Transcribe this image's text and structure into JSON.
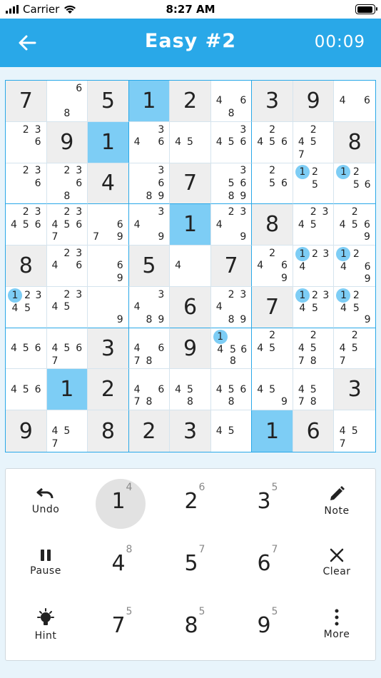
{
  "status_bar": {
    "carrier": "Carrier",
    "time": "8:27 AM"
  },
  "header": {
    "title": "Easy #2",
    "timer": "00:09"
  },
  "board": [
    [
      {
        "v": "7",
        "p": 1
      },
      {
        "n": [
          "",
          "",
          "6",
          "",
          "",
          "",
          "",
          "8",
          ""
        ]
      },
      {
        "v": "5",
        "p": 1
      },
      {
        "v": "1",
        "s": 1
      },
      {
        "v": "2",
        "p": 1
      },
      {
        "n": [
          "",
          "",
          "",
          "4",
          "",
          "6",
          "",
          "8",
          ""
        ]
      },
      {
        "v": "3",
        "p": 1
      },
      {
        "v": "9",
        "p": 1
      },
      {
        "n": [
          "",
          "",
          "",
          "4",
          "",
          "6",
          "",
          "",
          ""
        ]
      }
    ],
    [
      {
        "n": [
          "",
          "2",
          "3",
          "",
          "",
          "6",
          "",
          "",
          ""
        ]
      },
      {
        "v": "9",
        "p": 1
      },
      {
        "v": "1",
        "s": 1
      },
      {
        "n": [
          "",
          "",
          "3",
          "4",
          "",
          "6",
          "",
          "",
          ""
        ]
      },
      {
        "n": [
          "",
          "",
          "",
          "4",
          "5",
          "",
          "",
          "",
          ""
        ]
      },
      {
        "n": [
          "",
          "",
          "3",
          "4",
          "5",
          "6",
          "",
          "",
          ""
        ]
      },
      {
        "n": [
          "",
          "2",
          "",
          "4",
          "5",
          "6",
          "",
          "",
          ""
        ]
      },
      {
        "n": [
          "",
          "2",
          "",
          "4",
          "5",
          "",
          "7",
          "",
          ""
        ]
      },
      {
        "v": "8",
        "p": 1
      }
    ],
    [
      {
        "n": [
          "",
          "2",
          "3",
          "",
          "",
          "6",
          "",
          "",
          ""
        ]
      },
      {
        "n": [
          "",
          "2",
          "3",
          "",
          "",
          "6",
          "",
          "8",
          ""
        ]
      },
      {
        "v": "4",
        "p": 1
      },
      {
        "n": [
          "",
          "",
          "3",
          "",
          "",
          "6",
          "",
          "8",
          "9"
        ]
      },
      {
        "v": "7",
        "p": 1
      },
      {
        "n": [
          "",
          "",
          "3",
          "",
          "5",
          "6",
          "",
          "8",
          "9"
        ]
      },
      {
        "n": [
          "",
          "2",
          "",
          "",
          "5",
          "6",
          "",
          "",
          ""
        ]
      },
      {
        "n": [
          "1",
          "2",
          "",
          "",
          "5",
          "",
          "",
          "",
          ""
        ],
        "h": 0
      },
      {
        "n": [
          "1",
          "2",
          "",
          "",
          "5",
          "6",
          "",
          "",
          ""
        ],
        "h": 0
      }
    ],
    [
      {
        "n": [
          "",
          "2",
          "3",
          "4",
          "5",
          "6",
          "",
          "",
          ""
        ]
      },
      {
        "n": [
          "",
          "2",
          "3",
          "4",
          "5",
          "6",
          "7",
          "",
          ""
        ]
      },
      {
        "n": [
          "",
          "",
          "",
          "",
          "",
          "6",
          "7",
          "",
          "9"
        ]
      },
      {
        "n": [
          "",
          "",
          "3",
          "4",
          "",
          "",
          "",
          "",
          "9"
        ]
      },
      {
        "v": "1",
        "s": 1
      },
      {
        "n": [
          "",
          "2",
          "3",
          "4",
          "",
          "",
          "",
          "",
          "9"
        ]
      },
      {
        "v": "8",
        "p": 1
      },
      {
        "n": [
          "",
          "2",
          "3",
          "4",
          "5",
          "",
          "",
          "",
          ""
        ]
      },
      {
        "n": [
          "",
          "2",
          "",
          "4",
          "5",
          "6",
          "",
          "",
          "9"
        ]
      }
    ],
    [
      {
        "v": "8",
        "p": 1
      },
      {
        "n": [
          "",
          "2",
          "3",
          "4",
          "",
          "6",
          "",
          "",
          ""
        ]
      },
      {
        "n": [
          "",
          "",
          "",
          "",
          "",
          "6",
          "",
          "",
          "9"
        ]
      },
      {
        "v": "5",
        "p": 1
      },
      {
        "n": [
          "",
          "",
          "",
          "4",
          "",
          "",
          "",
          "",
          ""
        ]
      },
      {
        "v": "7",
        "p": 1
      },
      {
        "n": [
          "",
          "2",
          "",
          "4",
          "",
          "6",
          "",
          "",
          "9"
        ]
      },
      {
        "n": [
          "1",
          "2",
          "3",
          "4",
          "",
          "",
          "",
          "",
          ""
        ],
        "h": 0
      },
      {
        "n": [
          "1",
          "2",
          "",
          "4",
          "",
          "6",
          "",
          "",
          "9"
        ],
        "h": 0
      }
    ],
    [
      {
        "n": [
          "1",
          "2",
          "3",
          "4",
          "5",
          "",
          "",
          "",
          ""
        ],
        "h": 0
      },
      {
        "n": [
          "",
          "2",
          "3",
          "4",
          "5",
          "",
          "",
          "",
          ""
        ]
      },
      {
        "n": [
          "",
          "",
          "",
          "",
          "",
          "",
          "",
          "",
          "9"
        ]
      },
      {
        "n": [
          "",
          "",
          "3",
          "4",
          "",
          "",
          "",
          "8",
          "9"
        ]
      },
      {
        "v": "6",
        "p": 1
      },
      {
        "n": [
          "",
          "2",
          "3",
          "4",
          "",
          "",
          "",
          "8",
          "9"
        ]
      },
      {
        "v": "7",
        "p": 1
      },
      {
        "n": [
          "1",
          "2",
          "3",
          "4",
          "5",
          "",
          "",
          "",
          ""
        ],
        "h": 0
      },
      {
        "n": [
          "1",
          "2",
          "",
          "4",
          "5",
          "",
          "",
          "",
          "9"
        ],
        "h": 0
      }
    ],
    [
      {
        "n": [
          "",
          "",
          "",
          "4",
          "5",
          "6",
          "",
          "",
          ""
        ]
      },
      {
        "n": [
          "",
          "",
          "",
          "4",
          "5",
          "6",
          "7",
          "",
          ""
        ]
      },
      {
        "v": "3",
        "p": 1
      },
      {
        "n": [
          "",
          "",
          "",
          "4",
          "",
          "6",
          "7",
          "8",
          ""
        ]
      },
      {
        "v": "9",
        "p": 1
      },
      {
        "n": [
          "1",
          "",
          "",
          "4",
          "5",
          "6",
          "",
          "8",
          ""
        ],
        "h": 0
      },
      {
        "n": [
          "",
          "2",
          "",
          "4",
          "5",
          "",
          "",
          "",
          ""
        ]
      },
      {
        "n": [
          "",
          "2",
          "",
          "4",
          "5",
          "",
          "7",
          "8",
          ""
        ]
      },
      {
        "n": [
          "",
          "2",
          "",
          "4",
          "5",
          "",
          "7",
          "",
          ""
        ]
      }
    ],
    [
      {
        "n": [
          "",
          "",
          "",
          "4",
          "5",
          "6",
          "",
          "",
          ""
        ]
      },
      {
        "v": "1",
        "s": 1
      },
      {
        "v": "2",
        "p": 1
      },
      {
        "n": [
          "",
          "",
          "",
          "4",
          "",
          "6",
          "7",
          "8",
          ""
        ]
      },
      {
        "n": [
          "",
          "",
          "",
          "4",
          "5",
          "",
          "",
          "8",
          ""
        ]
      },
      {
        "n": [
          "",
          "",
          "",
          "4",
          "5",
          "6",
          "",
          "8",
          ""
        ]
      },
      {
        "n": [
          "",
          "",
          "",
          "4",
          "5",
          "",
          "",
          "",
          "9"
        ]
      },
      {
        "n": [
          "",
          "",
          "",
          "4",
          "5",
          "",
          "7",
          "8",
          ""
        ]
      },
      {
        "v": "3",
        "p": 1
      }
    ],
    [
      {
        "v": "9",
        "p": 1
      },
      {
        "n": [
          "",
          "",
          "",
          "4",
          "5",
          "",
          "7",
          "",
          ""
        ]
      },
      {
        "v": "8",
        "p": 1
      },
      {
        "v": "2",
        "p": 1
      },
      {
        "v": "3",
        "p": 1
      },
      {
        "n": [
          "",
          "",
          "",
          "4",
          "5",
          "",
          "",
          "",
          ""
        ]
      },
      {
        "v": "1",
        "s": 1
      },
      {
        "v": "6",
        "p": 1
      },
      {
        "n": [
          "",
          "",
          "",
          "4",
          "5",
          "",
          "7",
          "",
          ""
        ]
      }
    ]
  ],
  "keypad": {
    "undo": "Undo",
    "note": "Note",
    "pause": "Pause",
    "clear": "Clear",
    "hint": "Hint",
    "more": "More",
    "numbers": [
      {
        "digit": "1",
        "count": "4"
      },
      {
        "digit": "2",
        "count": "6"
      },
      {
        "digit": "3",
        "count": "5"
      },
      {
        "digit": "4",
        "count": "8"
      },
      {
        "digit": "5",
        "count": "7"
      },
      {
        "digit": "6",
        "count": "7"
      },
      {
        "digit": "7",
        "count": "5"
      },
      {
        "digit": "8",
        "count": "5"
      },
      {
        "digit": "9",
        "count": "5"
      }
    ],
    "active_digit": "1"
  },
  "colors": {
    "accent": "#29a8e8",
    "selected": "#7dcdf5",
    "prefilled": "#eeeeee"
  }
}
